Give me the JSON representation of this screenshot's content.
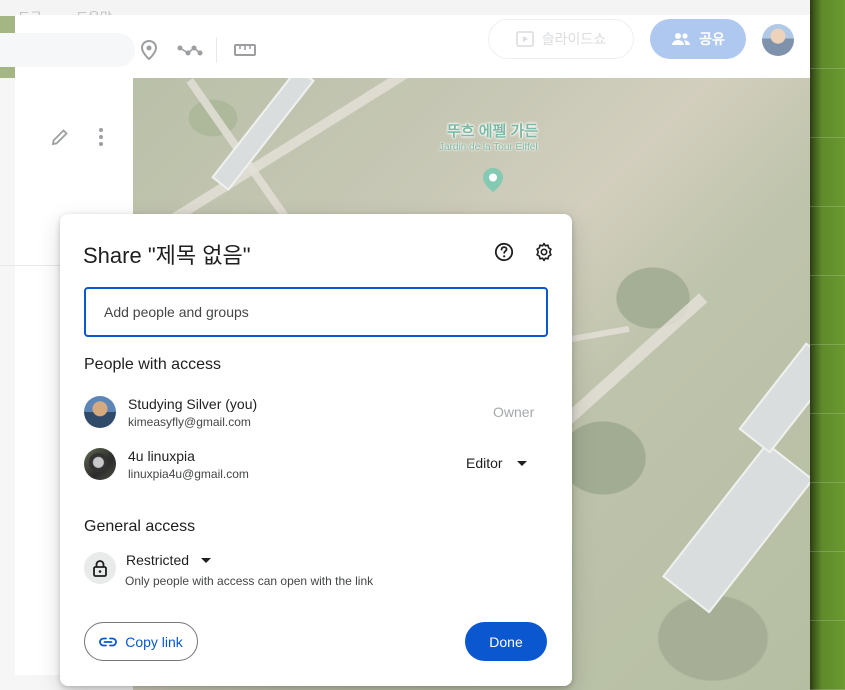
{
  "menubar": {
    "items": [
      "도구",
      "도움말"
    ]
  },
  "toolbar": {
    "slideshow_label": "슬라이드쇼",
    "share_label": "공유"
  },
  "map": {
    "label_ko": "뚜흐 에펠 가든",
    "label_fr": "Jardin de la Tour Eiffel"
  },
  "dialog": {
    "title": "Share \"제목 없음\"",
    "add_placeholder": "Add people and groups",
    "people_heading": "People with access",
    "people": [
      {
        "name": "Studying Silver (you)",
        "email": "kimeasyfly@gmail.com",
        "role": "Owner"
      },
      {
        "name": "4u linuxpia",
        "email": "linuxpia4u@gmail.com",
        "role": "Editor"
      }
    ],
    "general_heading": "General access",
    "access_level": "Restricted",
    "access_desc": "Only people with access can open with the link",
    "copy_link_label": "Copy link",
    "done_label": "Done"
  },
  "colors": {
    "primary": "#0b57d0",
    "share_button": "#7ea6e6"
  }
}
